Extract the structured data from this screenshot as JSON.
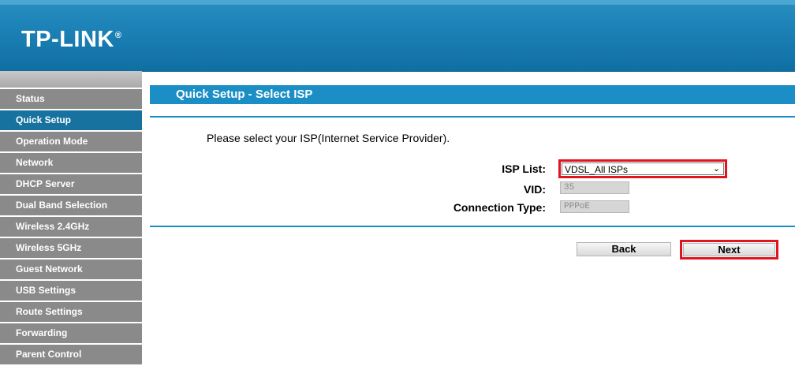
{
  "header": {
    "logo_text": "TP-LINK",
    "logo_reg": "®",
    "colors": {
      "header_blue": "#1e83b8",
      "accent_blue": "#1b8fc5",
      "nav_gray": "#8a8a8a",
      "nav_active": "#17729f",
      "highlight_red": "#e0151f"
    }
  },
  "sidebar": {
    "items": [
      {
        "label": "Status",
        "active": false
      },
      {
        "label": "Quick Setup",
        "active": true
      },
      {
        "label": "Operation Mode",
        "active": false
      },
      {
        "label": "Network",
        "active": false
      },
      {
        "label": "DHCP Server",
        "active": false
      },
      {
        "label": "Dual Band Selection",
        "active": false
      },
      {
        "label": "Wireless 2.4GHz",
        "active": false
      },
      {
        "label": "Wireless 5GHz",
        "active": false
      },
      {
        "label": "Guest Network",
        "active": false
      },
      {
        "label": "USB Settings",
        "active": false
      },
      {
        "label": "Route Settings",
        "active": false
      },
      {
        "label": "Forwarding",
        "active": false
      },
      {
        "label": "Parent Control",
        "active": false
      }
    ]
  },
  "main": {
    "title": "Quick Setup - Select ISP",
    "instruction": "Please select your ISP(Internet Service Provider).",
    "form": {
      "isp_list_label": "ISP List:",
      "isp_list_value": "VDSL_All ISPs",
      "vid_label": "VID:",
      "vid_value": "35",
      "connection_type_label": "Connection Type:",
      "connection_type_value": "PPPoE"
    },
    "buttons": {
      "back_label": "Back",
      "next_label": "Next"
    }
  }
}
